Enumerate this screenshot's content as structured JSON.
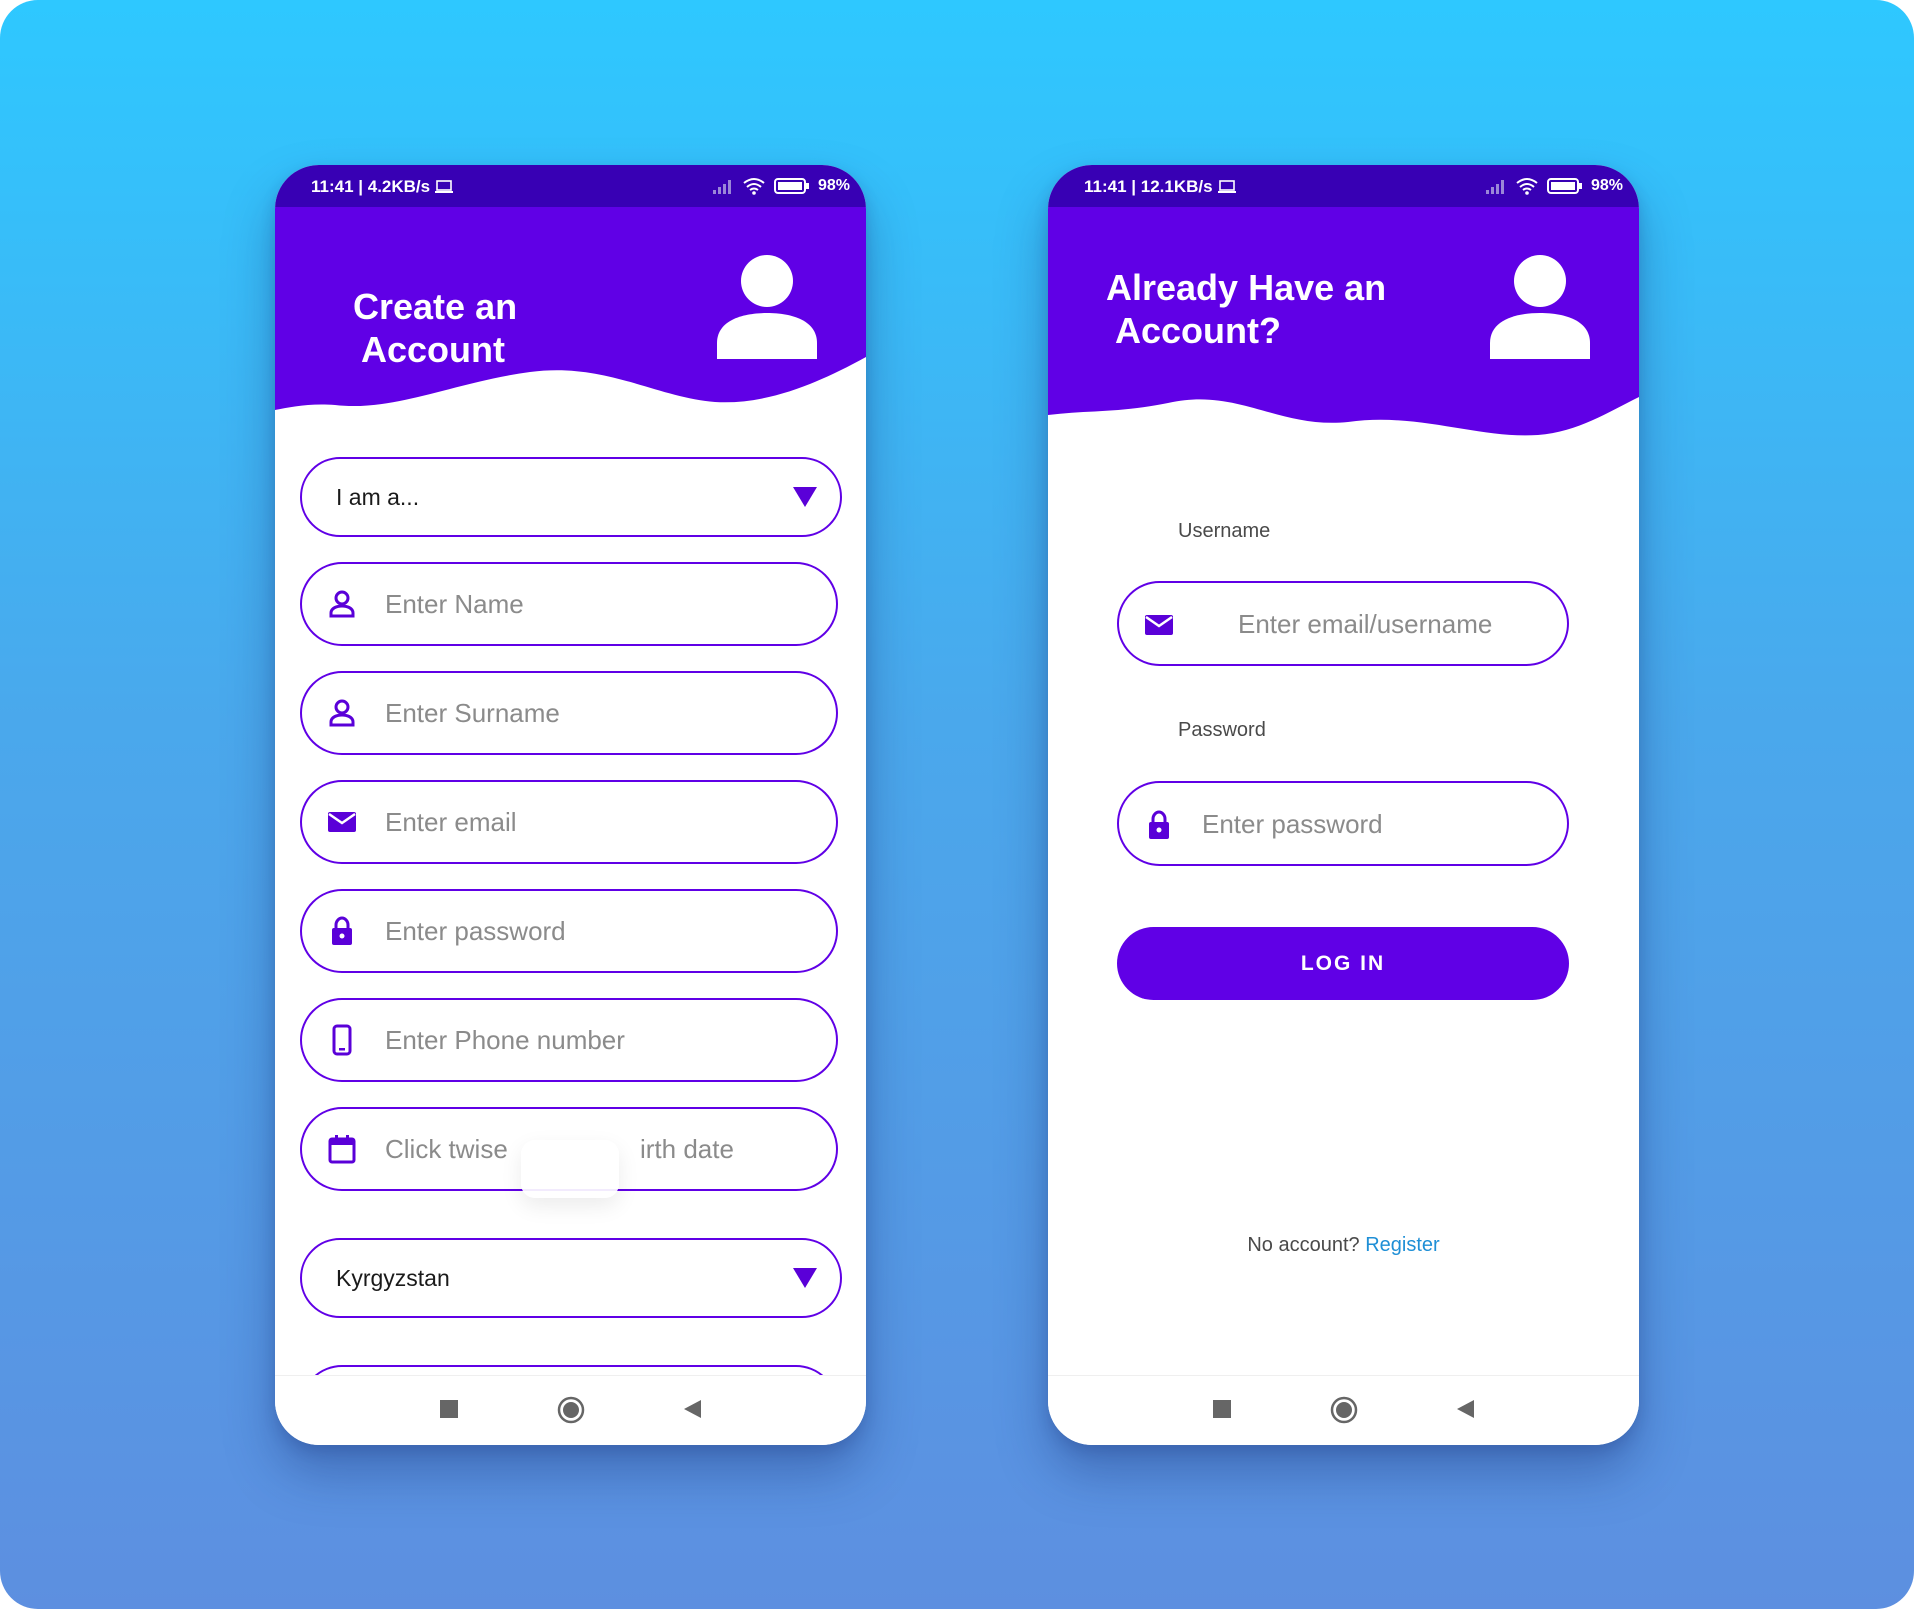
{
  "colors": {
    "brand": "#6000e6",
    "status_bar": "#3800b4",
    "link": "#1f8fd6",
    "background_top": "#2ec8ff",
    "background_bottom": "#5d8fe0"
  },
  "register_screen": {
    "status": {
      "time_speed": "11:41 | 4.2KB/s",
      "battery": "98%"
    },
    "title_line1": "Create an",
    "title_line2": "Account",
    "role_select": {
      "value": "I am a..."
    },
    "fields": [
      {
        "icon": "person-icon",
        "placeholder": "Enter Name"
      },
      {
        "icon": "person-icon",
        "placeholder": "Enter Surname"
      },
      {
        "icon": "mail-icon",
        "placeholder": "Enter email"
      },
      {
        "icon": "lock-icon",
        "placeholder": "Enter password"
      },
      {
        "icon": "phone-icon",
        "placeholder": "Enter Phone number"
      },
      {
        "icon": "calendar-icon",
        "placeholder_part1": "Click twise",
        "placeholder_part2": "irth date"
      }
    ],
    "country_select": {
      "value": "Kyrgyzstan"
    }
  },
  "login_screen": {
    "status": {
      "time_speed": "11:41 | 12.1KB/s",
      "battery": "98%"
    },
    "title_line1": "Already Have an",
    "title_line2": "Account?",
    "username_label": "Username",
    "username_placeholder": "Enter email/username",
    "password_label": "Password",
    "password_placeholder": "Enter password",
    "login_button": "LOG IN",
    "no_account_text": "No account?",
    "register_link": "Register"
  }
}
